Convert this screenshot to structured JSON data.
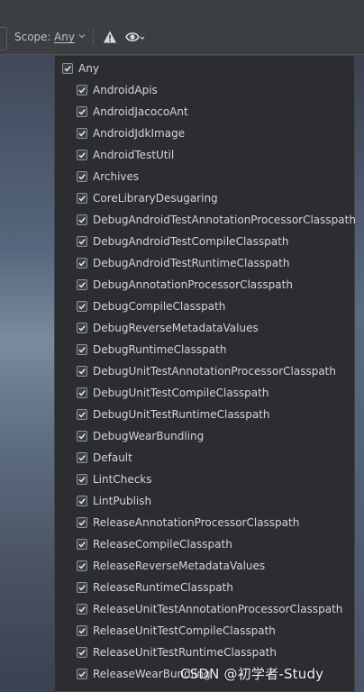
{
  "toolbar": {
    "scope_label": "Scope:",
    "scope_value": "Any",
    "icons": [
      "chevron-down-icon",
      "warning-icon",
      "eye-icon"
    ]
  },
  "popup": {
    "items": [
      {
        "label": "Any",
        "checked": true
      },
      {
        "label": "AndroidApis",
        "checked": true
      },
      {
        "label": "AndroidJacocoAnt",
        "checked": true
      },
      {
        "label": "AndroidJdkImage",
        "checked": true
      },
      {
        "label": "AndroidTestUtil",
        "checked": true
      },
      {
        "label": "Archives",
        "checked": true
      },
      {
        "label": "CoreLibraryDesugaring",
        "checked": true
      },
      {
        "label": "DebugAndroidTestAnnotationProcessorClasspath",
        "checked": true
      },
      {
        "label": "DebugAndroidTestCompileClasspath",
        "checked": true
      },
      {
        "label": "DebugAndroidTestRuntimeClasspath",
        "checked": true
      },
      {
        "label": "DebugAnnotationProcessorClasspath",
        "checked": true
      },
      {
        "label": "DebugCompileClasspath",
        "checked": true
      },
      {
        "label": "DebugReverseMetadataValues",
        "checked": true
      },
      {
        "label": "DebugRuntimeClasspath",
        "checked": true
      },
      {
        "label": "DebugUnitTestAnnotationProcessorClasspath",
        "checked": true
      },
      {
        "label": "DebugUnitTestCompileClasspath",
        "checked": true
      },
      {
        "label": "DebugUnitTestRuntimeClasspath",
        "checked": true
      },
      {
        "label": "DebugWearBundling",
        "checked": true
      },
      {
        "label": "Default",
        "checked": true
      },
      {
        "label": "LintChecks",
        "checked": true
      },
      {
        "label": "LintPublish",
        "checked": true
      },
      {
        "label": "ReleaseAnnotationProcessorClasspath",
        "checked": true
      },
      {
        "label": "ReleaseCompileClasspath",
        "checked": true
      },
      {
        "label": "ReleaseReverseMetadataValues",
        "checked": true
      },
      {
        "label": "ReleaseRuntimeClasspath",
        "checked": true
      },
      {
        "label": "ReleaseUnitTestAnnotationProcessorClasspath",
        "checked": true
      },
      {
        "label": "ReleaseUnitTestCompileClasspath",
        "checked": true
      },
      {
        "label": "ReleaseUnitTestRuntimeClasspath",
        "checked": true
      },
      {
        "label": "ReleaseWearBundling",
        "checked": true
      }
    ]
  },
  "watermark": "CSDN @初学者-Study",
  "colors": {
    "popup_bg": "#2b2d30",
    "toolbar_bg": "#3c3f41",
    "text": "#d3d5d8"
  }
}
